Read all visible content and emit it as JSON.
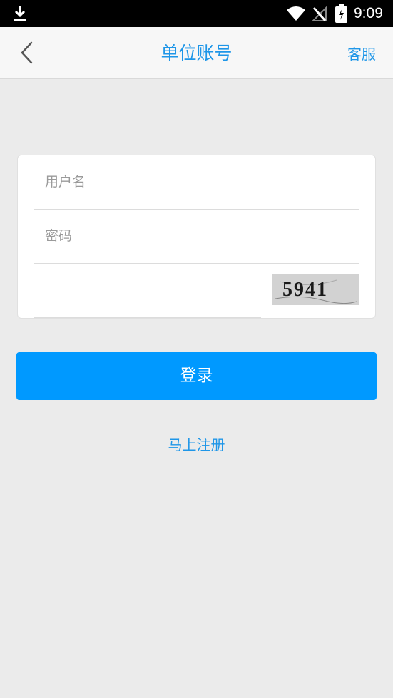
{
  "status_bar": {
    "time": "9:09",
    "icons": [
      "download-icon",
      "wifi-icon",
      "no-signal-icon",
      "battery-charging-icon"
    ]
  },
  "header": {
    "title": "单位账号",
    "service_label": "客服",
    "back_icon": "chevron-left-icon"
  },
  "form": {
    "username_placeholder": "用户名",
    "password_placeholder": "密码",
    "captcha_placeholder": "",
    "captcha_text": "5941"
  },
  "actions": {
    "login_label": "登录",
    "register_label": "马上注册"
  },
  "colors": {
    "accent": "#1e96e8",
    "button": "#0099ff",
    "background": "#ebebeb"
  }
}
